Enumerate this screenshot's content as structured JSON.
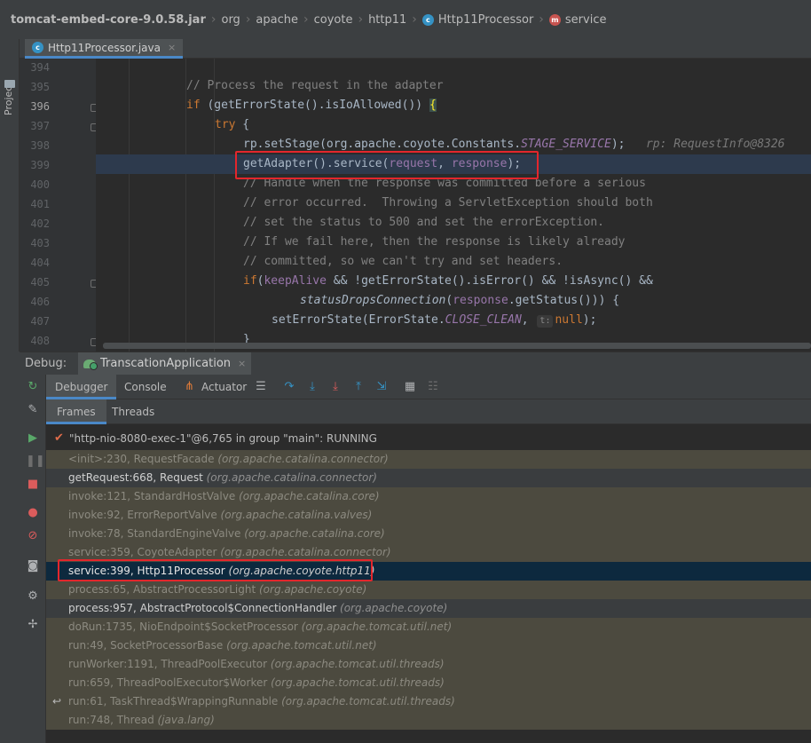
{
  "breadcrumb": [
    {
      "label": "tomcat-embed-core-9.0.58.jar"
    },
    {
      "label": "org"
    },
    {
      "label": "apache"
    },
    {
      "label": "coyote"
    },
    {
      "label": "http11"
    },
    {
      "label": "Http11Processor",
      "icon": "c"
    },
    {
      "label": "service",
      "icon": "m"
    }
  ],
  "sidebar": {
    "project_label": "Project"
  },
  "editor": {
    "tab_label": "Http11Processor.java",
    "close_glyph": "×",
    "lines": [
      {
        "n": "394"
      },
      {
        "n": "395"
      },
      {
        "n": "396"
      },
      {
        "n": "397"
      },
      {
        "n": "398"
      },
      {
        "n": "399"
      },
      {
        "n": "400"
      },
      {
        "n": "401"
      },
      {
        "n": "402"
      },
      {
        "n": "403"
      },
      {
        "n": "404"
      },
      {
        "n": "405"
      },
      {
        "n": "406"
      },
      {
        "n": "407"
      },
      {
        "n": "408"
      }
    ],
    "code": {
      "l395": "// Process the request in the adapter",
      "l396_kw": "if",
      "l396_a": " (getErrorState().isIoAllowed()) ",
      "l396_b": "{",
      "l397": "try",
      "l397_b": " {",
      "l398_a": "rp.setStage(org.apache.coyote.Constants.",
      "l398_c": "STAGE_SERVICE",
      "l398_d": ");",
      "l398_hint": "rp: RequestInfo@8326",
      "l399_a": "getAdapter().service(",
      "l399_p1": "request",
      "l399_s": ", ",
      "l399_p2": "response",
      "l399_e": ");",
      "l400": "// Handle when the response was committed before a serious",
      "l401": "// error occurred.  Throwing a ServletException should both",
      "l402": "// set the status to 500 and set the errorException.",
      "l403": "// If we fail here, then the response is likely already",
      "l404": "// committed, so we can't try and set headers.",
      "l405_kw": "if",
      "l405_a": "(",
      "l405_p": "keepAlive",
      "l405_b": " && !getErrorState().isError() && !isAsync() &&",
      "l406_fn": "statusDropsConnection",
      "l406_a": "(",
      "l406_p": "response",
      "l406_b": ".getStatus())) {",
      "l407_a": "setErrorState(ErrorState.",
      "l407_c": "CLOSE_CLEAN",
      "l407_s": ", ",
      "l407_t": "t:",
      "l407_n": "null",
      "l407_e": ");",
      "l408": "}"
    }
  },
  "debug": {
    "label": "Debug:",
    "session_tab": "TranscationApplication",
    "close_glyph": "×",
    "tabs": [
      "Debugger",
      "Console",
      "Actuator"
    ],
    "frame_tabs": [
      "Frames",
      "Threads"
    ],
    "thread": "\"http-nio-8080-exec-1\"@6,765 in group \"main\": RUNNING",
    "frames": [
      {
        "method": "<init>:230, RequestFacade",
        "pkg": "(org.apache.catalina.connector)",
        "kind": "lib"
      },
      {
        "method": "getRequest:668, Request",
        "pkg": "(org.apache.catalina.connector)",
        "kind": "app"
      },
      {
        "method": "invoke:121, StandardHostValve",
        "pkg": "(org.apache.catalina.core)",
        "kind": "lib"
      },
      {
        "method": "invoke:92, ErrorReportValve",
        "pkg": "(org.apache.catalina.valves)",
        "kind": "lib"
      },
      {
        "method": "invoke:78, StandardEngineValve",
        "pkg": "(org.apache.catalina.core)",
        "kind": "lib"
      },
      {
        "method": "service:359, CoyoteAdapter",
        "pkg": "(org.apache.catalina.connector)",
        "kind": "lib"
      },
      {
        "method": "service:399, Http11Processor",
        "pkg": "(org.apache.coyote.http11)",
        "kind": "sel"
      },
      {
        "method": "process:65, AbstractProcessorLight",
        "pkg": "(org.apache.coyote)",
        "kind": "lib"
      },
      {
        "method": "process:957, AbstractProtocol$ConnectionHandler",
        "pkg": "(org.apache.coyote)",
        "kind": "app"
      },
      {
        "method": "doRun:1735, NioEndpoint$SocketProcessor",
        "pkg": "(org.apache.tomcat.util.net)",
        "kind": "lib"
      },
      {
        "method": "run:49, SocketProcessorBase",
        "pkg": "(org.apache.tomcat.util.net)",
        "kind": "lib"
      },
      {
        "method": "runWorker:1191, ThreadPoolExecutor",
        "pkg": "(org.apache.tomcat.util.threads)",
        "kind": "lib"
      },
      {
        "method": "run:659, ThreadPoolExecutor$Worker",
        "pkg": "(org.apache.tomcat.util.threads)",
        "kind": "lib"
      },
      {
        "method": "run:61, TaskThread$WrappingRunnable",
        "pkg": "(org.apache.tomcat.util.threads)",
        "kind": "lib",
        "back": true
      },
      {
        "method": "run:748, Thread",
        "pkg": "(java.lang)",
        "kind": "lib"
      }
    ]
  }
}
